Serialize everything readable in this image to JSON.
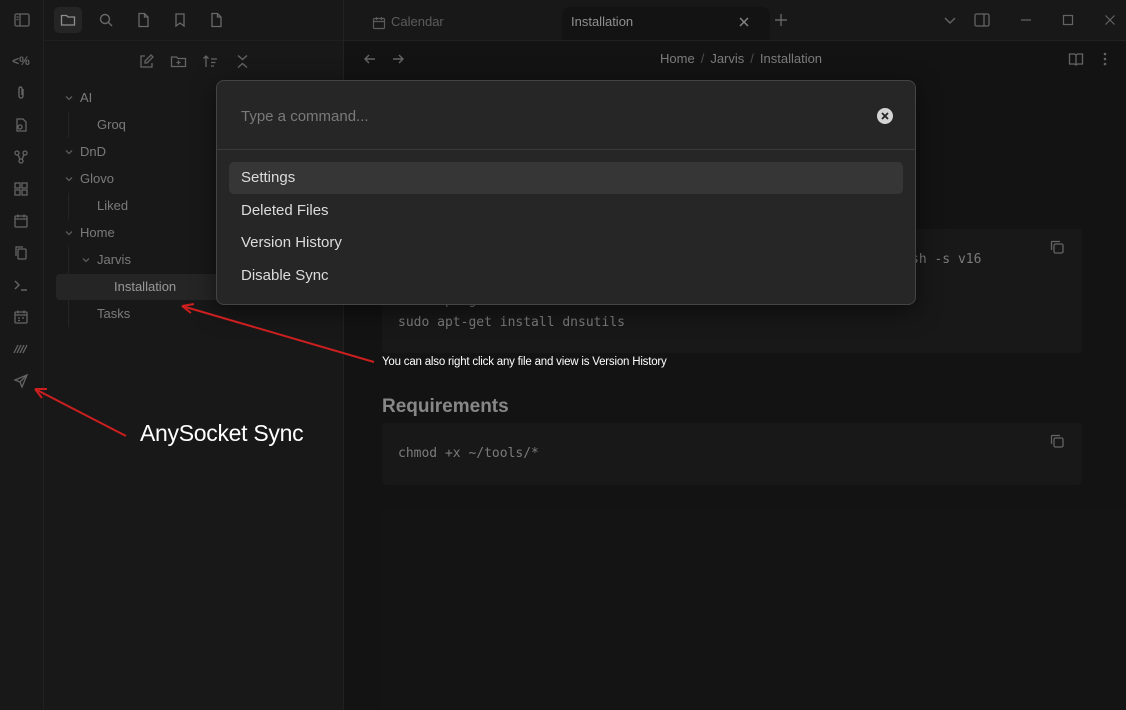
{
  "ribbon": {
    "items": [
      {
        "name": "templater",
        "label": "<%"
      },
      {
        "name": "paperclip-icon"
      },
      {
        "name": "file-import-icon"
      },
      {
        "name": "graph-icon"
      },
      {
        "name": "canvas-icon"
      },
      {
        "name": "calendar-icon"
      },
      {
        "name": "copy-files-icon"
      },
      {
        "name": "terminal-icon"
      },
      {
        "name": "daily-note-icon"
      },
      {
        "name": "excalidraw-icon"
      },
      {
        "name": "send-icon"
      }
    ]
  },
  "sidebar": {
    "tabs": [
      "files",
      "search",
      "file",
      "bookmarks",
      "file-outline"
    ],
    "active_tab": "files",
    "tree": [
      {
        "label": "AI",
        "type": "folder",
        "depth": 0
      },
      {
        "label": "Groq",
        "type": "file",
        "depth": 1
      },
      {
        "label": "DnD",
        "type": "folder",
        "depth": 0
      },
      {
        "label": "Glovo",
        "type": "folder",
        "depth": 0
      },
      {
        "label": "Liked",
        "type": "file",
        "depth": 1
      },
      {
        "label": "Home",
        "type": "folder",
        "depth": 0
      },
      {
        "label": "Jarvis",
        "type": "folder",
        "depth": 1
      },
      {
        "label": "Installation",
        "type": "file",
        "depth": 2,
        "active": true
      },
      {
        "label": "Tasks",
        "type": "file",
        "depth": 1
      }
    ]
  },
  "tabs": [
    {
      "label": "Calendar",
      "active": false
    },
    {
      "label": "Installation",
      "active": true
    }
  ],
  "breadcrumb": {
    "part1": "Home",
    "sep": "/",
    "part2": "Jarvis",
    "part3": "Installation"
  },
  "content": {
    "code1_visible_tail": "sh -s v16",
    "code1_partial": "sudo apt-get install build-essential",
    "code1_line": "sudo apt-get install dnsutils",
    "requirements_heading": "Requirements",
    "code2_line": "chmod +x ~/tools/*"
  },
  "command_palette": {
    "placeholder": "Type a command...",
    "items": [
      {
        "label": "Settings",
        "selected": true
      },
      {
        "label": "Deleted Files",
        "selected": false
      },
      {
        "label": "Version History",
        "selected": false
      },
      {
        "label": "Disable Sync",
        "selected": false
      }
    ]
  },
  "annotations": {
    "context_menu_note": "You can also right click any file and view is Version History",
    "plugin_note": "AnySocket Sync"
  },
  "colors": {
    "annotation_arrow": "#cc1f1f",
    "background": "#1e1e1e",
    "panel": "#262626"
  }
}
